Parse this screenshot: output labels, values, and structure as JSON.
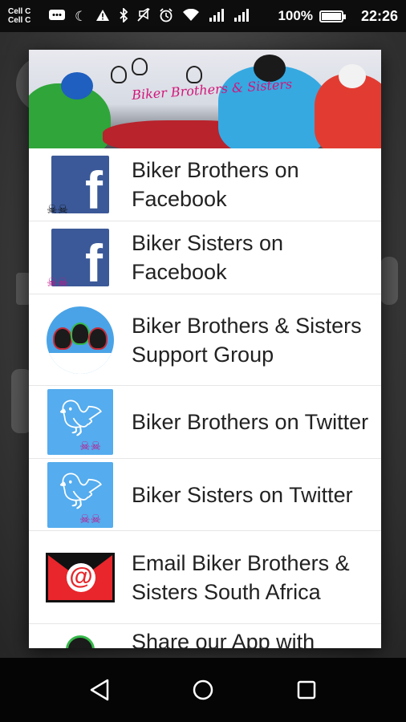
{
  "status_bar": {
    "carrier_lines": [
      "Cell C",
      "Cell C"
    ],
    "icons": [
      "chat-icon",
      "moon-icon",
      "warning-icon",
      "bluetooth-icon",
      "mute-icon",
      "alarm-icon",
      "wifi-icon",
      "signal-icon",
      "signal-icon"
    ],
    "battery_percent": "100%",
    "battery_level": 1.0,
    "time": "22:26"
  },
  "dialog": {
    "banner_title": "Biker Brothers & Sisters",
    "items": [
      {
        "label": "Biker Brothers on Facebook",
        "icon": "facebook-icon"
      },
      {
        "label": "Biker Sisters on Facebook",
        "icon": "facebook-icon"
      },
      {
        "label": "Biker Brothers & Sisters Support Group",
        "icon": "helmets-group-icon"
      },
      {
        "label": "Biker Brothers on Twitter",
        "icon": "twitter-icon"
      },
      {
        "label": "Biker Sisters  on Twitter",
        "icon": "twitter-icon"
      },
      {
        "label": "Email Biker Brothers & Sisters South Africa",
        "icon": "email-icon"
      },
      {
        "label": "Share our App with",
        "icon": "share-icon"
      }
    ]
  },
  "nav_bar": {
    "buttons": [
      "back-icon",
      "home-icon",
      "recents-icon"
    ]
  },
  "colors": {
    "facebook": "#3b5998",
    "twitter": "#55acee",
    "email": "#e8262b",
    "accent_pink": "#d4147a"
  }
}
